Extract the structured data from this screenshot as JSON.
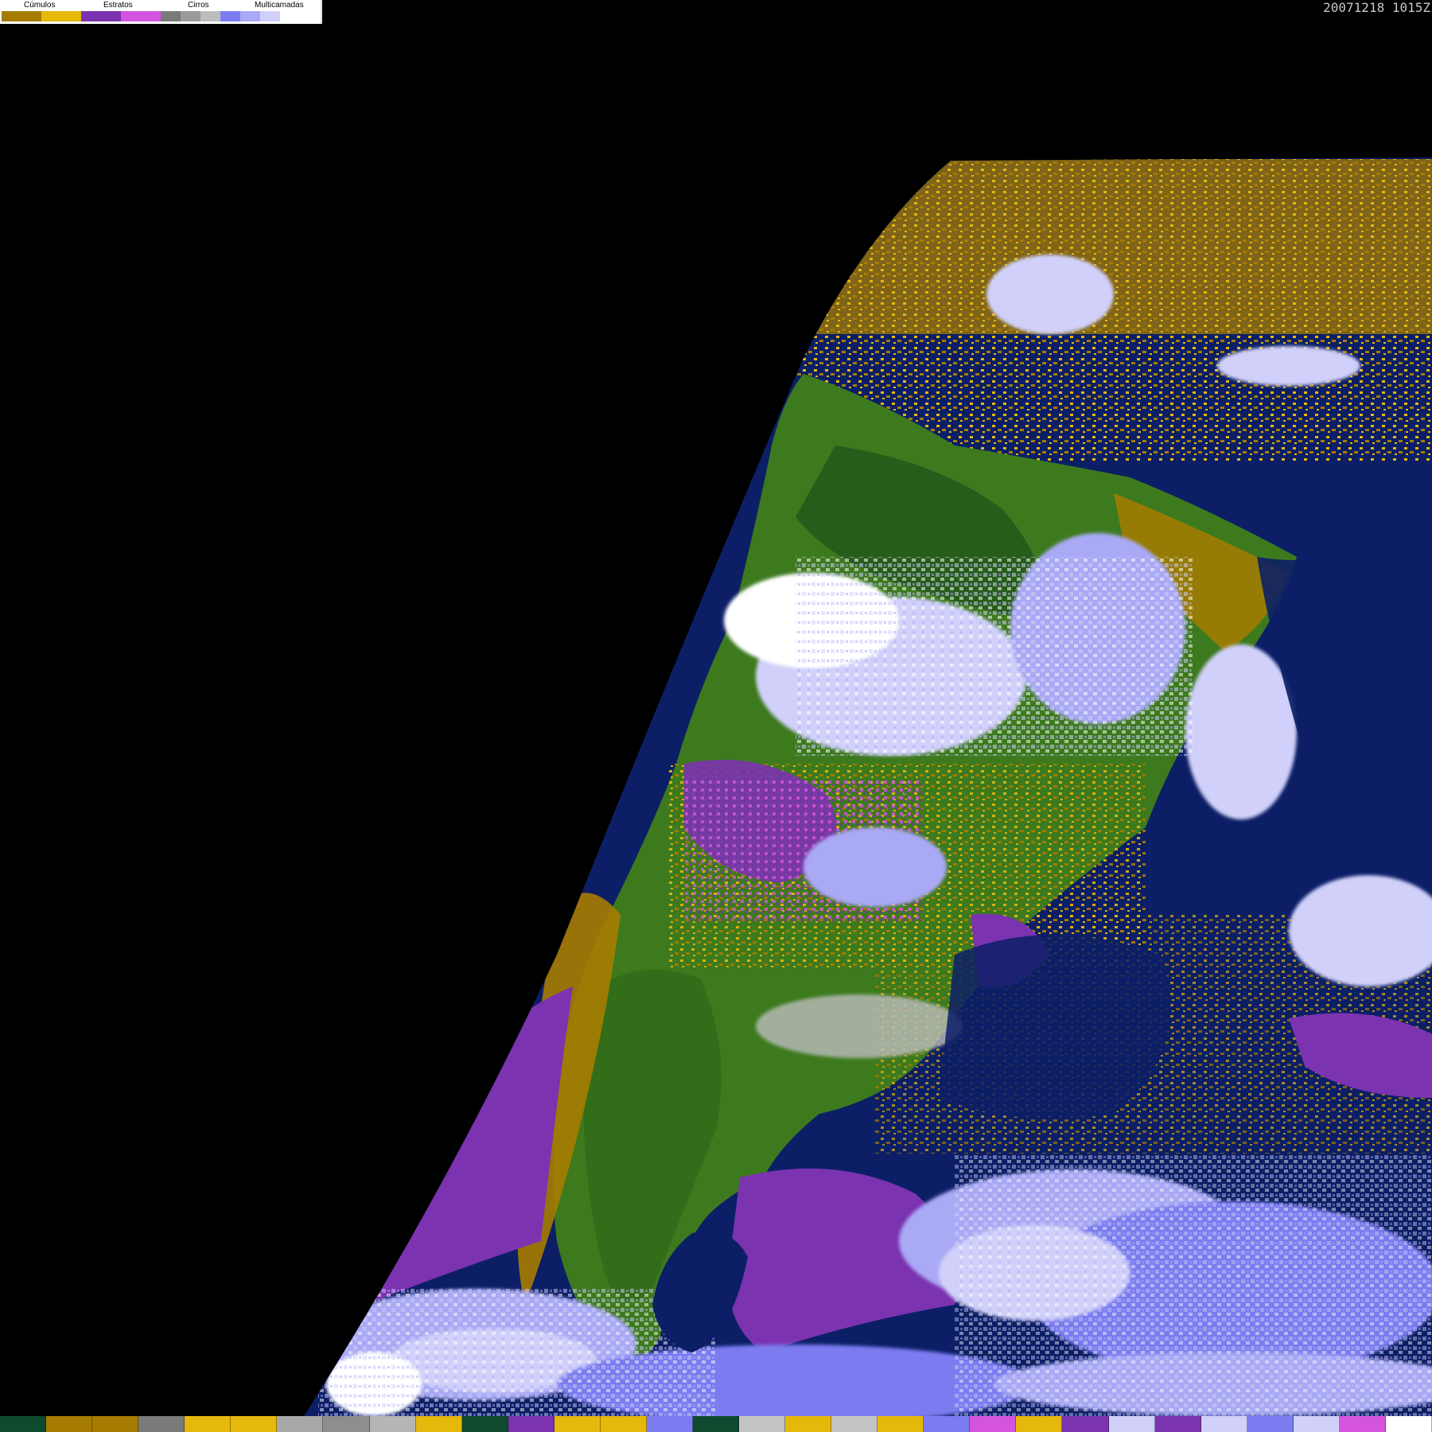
{
  "legend": {
    "categories": [
      {
        "label": "Cúmulos",
        "colors": [
          "#a67c00",
          "#e5b80b"
        ]
      },
      {
        "label": "Estratos",
        "colors": [
          "#7b33b0",
          "#d454e0"
        ]
      },
      {
        "label": "Cirros",
        "colors": [
          "#7a7a7a",
          "#9a9a9a",
          "#bdbdbd"
        ]
      },
      {
        "label": "Multicamadas",
        "colors": [
          "#7c7cf0",
          "#a9a9f5",
          "#d0d0fa",
          "#ffffff"
        ]
      }
    ]
  },
  "timestamp": "20071218 1015Z",
  "palette": {
    "space": "#000000",
    "ocean": "#0c1f66",
    "land": "#3d7a1e",
    "land_dark": "#21561a",
    "cumulus_dark": "#a67c00",
    "cumulus_light": "#e5b80b",
    "stratus_dark": "#7b33b0",
    "stratus_light": "#d454e0",
    "cirrus_dark": "#7a7a7a",
    "cirrus_light": "#bdbdbd",
    "multi_dark": "#7c7cf0",
    "multi_mid": "#a9a9f5",
    "multi_light": "#d0d0fa",
    "white": "#ffffff"
  },
  "bottom_bar_colors": [
    "#0e4a2e",
    "#a67c00",
    "#a67c00",
    "#7a7a7a",
    "#e5b80b",
    "#e5b80b",
    "#a8a8a8",
    "#8e8e8e",
    "#b5b5b5",
    "#e5b80b",
    "#0e4a2e",
    "#7b33b0",
    "#e5b80b",
    "#e5b80b",
    "#7c7cf0",
    "#0e4a2e",
    "#c4c4c4",
    "#e5b80b",
    "#c4c4c4",
    "#e5b80b",
    "#7c7cf0",
    "#d454e0",
    "#e5b80b",
    "#7b33b0",
    "#d0d0fa",
    "#7b33b0",
    "#d0d0fa",
    "#7c7cf0",
    "#d0d0fa",
    "#d454e0",
    "#ffffff"
  ]
}
